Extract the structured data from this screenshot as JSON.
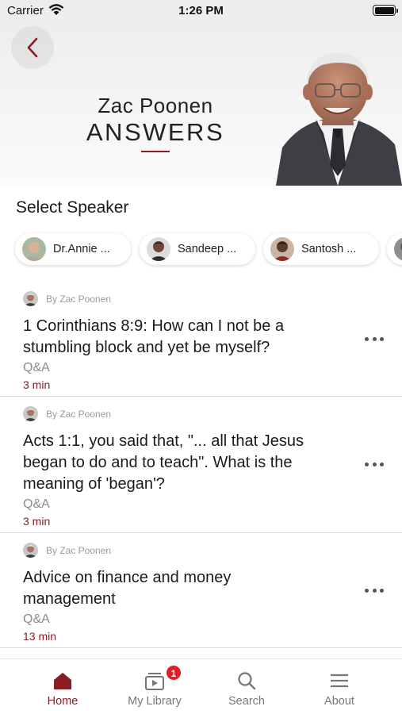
{
  "status_bar": {
    "carrier": "Carrier",
    "time": "1:26 PM"
  },
  "header": {
    "title": "Zac Poonen",
    "subtitle": "ANSWERS"
  },
  "speakers": {
    "heading": "Select Speaker",
    "chips": [
      {
        "label": "Dr.Annie ..."
      },
      {
        "label": "Sandeep ..."
      },
      {
        "label": "Santosh ..."
      }
    ]
  },
  "feed": [
    {
      "by": "By Zac Poonen",
      "title_lines": [
        "1 Corinthians 8:9: How can I not be a",
        "stumbling block and yet be myself?"
      ],
      "type": "Q&A",
      "duration": "3 min"
    },
    {
      "by": "By Zac Poonen",
      "title_lines": [
        "Acts 1:1, you said that, \"... all that Jesus",
        "began to do and to teach\". What is the",
        "meaning of 'began'?"
      ],
      "type": "Q&A",
      "duration": "3 min"
    },
    {
      "by": "By Zac Poonen",
      "title_lines": [
        "Advice on finance and money",
        "management"
      ],
      "type": "Q&A",
      "duration": "13 min"
    }
  ],
  "tabbar": {
    "tabs": [
      {
        "label": "Home",
        "icon": "home-icon",
        "active": true
      },
      {
        "label": "My Library",
        "icon": "library-icon",
        "badge": "1"
      },
      {
        "label": "Search",
        "icon": "search-icon"
      },
      {
        "label": "About",
        "icon": "menu-icon"
      }
    ]
  },
  "colors": {
    "accent": "#8a1c24",
    "badge": "#e01f25",
    "text": "#1a1a1a",
    "muted": "#8c8c8c"
  }
}
